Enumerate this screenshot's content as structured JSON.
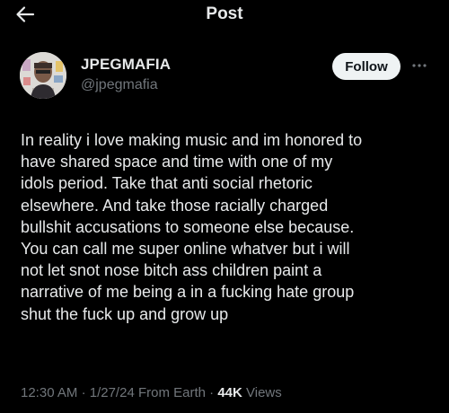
{
  "header": {
    "title": "Post"
  },
  "author": {
    "display_name": "JPEGMAFIA",
    "handle": "@jpegmafia",
    "follow_label": "Follow"
  },
  "post": {
    "text": "In reality i love making music and im honored to\nhave shared space and time with one of my\nidols period. Take that anti social rhetoric\nelsewhere. And take those racially charged\nbullshit accusations to someone else because.\nYou can call me super online whatver but i will\nnot let snot nose bitch ass children paint a\nnarrative of me being a in a fucking hate group\nshut the fuck up and grow up",
    "time": "12:30 AM",
    "date": "1/27/24",
    "source": "From Earth",
    "views_count": "44K",
    "views_label": "Views"
  },
  "icons": {
    "back": "arrow-left-icon",
    "more": "more-horizontal-icon"
  },
  "colors": {
    "background": "#000000",
    "primary_text": "#e7e9ea",
    "secondary_text": "#71767b",
    "follow_bg": "#eff3f4"
  }
}
